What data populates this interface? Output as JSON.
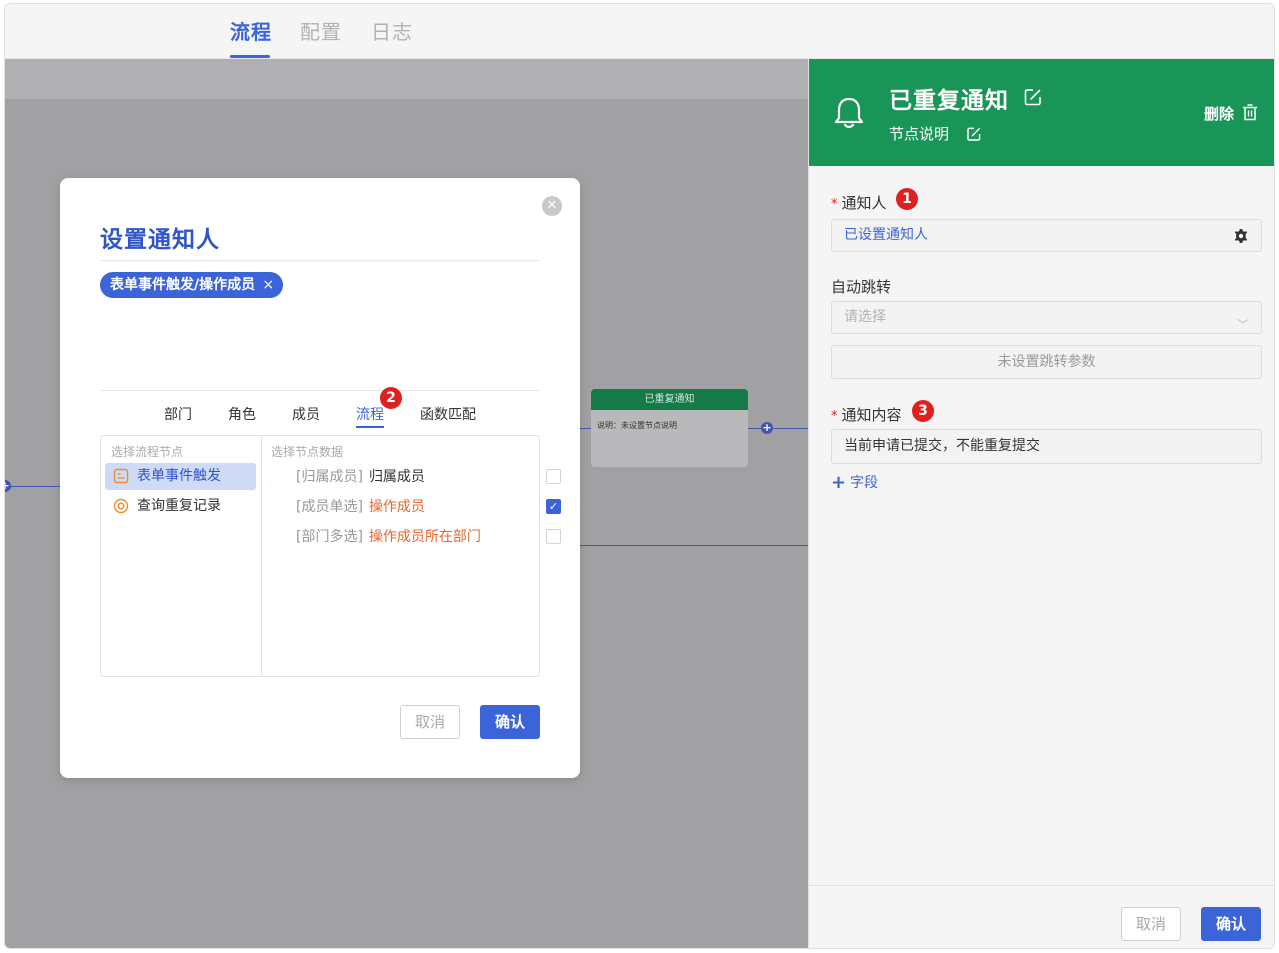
{
  "top_tabs": [
    {
      "label": "流程",
      "active": true
    },
    {
      "label": "配置",
      "active": false
    },
    {
      "label": "日志",
      "active": false
    }
  ],
  "canvas": {
    "node": {
      "title": "已重复通知",
      "description": "说明：未设置节点说明"
    }
  },
  "modal": {
    "title": "设置通知人",
    "close_icon": "close-circle-icon",
    "chip": {
      "label": "表单事件触发/操作成员",
      "remove_icon": "×"
    },
    "tabs": [
      {
        "label": "部门"
      },
      {
        "label": "角色"
      },
      {
        "label": "成员"
      },
      {
        "label": "流程",
        "active": true
      },
      {
        "label": "函数匹配"
      }
    ],
    "tab_badge": "2",
    "left_hint": "选择流程节点",
    "right_hint": "选择节点数据",
    "nodes": [
      {
        "label": "表单事件触发",
        "icon": "form-icon",
        "selected": true
      },
      {
        "label": "查询重复记录",
        "icon": "query-icon",
        "selected": false
      }
    ],
    "fields": [
      {
        "tag": "[归属成员]",
        "name": "归属成员",
        "checked": false
      },
      {
        "tag": "[成员单选]",
        "name": "操作成员",
        "checked": true
      },
      {
        "tag": "[部门多选]",
        "name": "操作成员所在部门",
        "checked": false
      }
    ],
    "cancel_label": "取消",
    "confirm_label": "确认"
  },
  "panel": {
    "title": "已重复通知",
    "subtitle": "节点说明",
    "delete_label": "删除",
    "notifier_label": "通知人",
    "notifier_badge": "1",
    "notifier_value": "已设置通知人",
    "auto_jump_label": "自动跳转",
    "auto_jump_placeholder": "请选择",
    "jump_params_label": "未设置跳转参数",
    "content_label": "通知内容",
    "content_badge": "3",
    "content_value": "当前申请已提交，不能重复提交",
    "add_field_label": "字段",
    "cancel_label": "取消",
    "confirm_label": "确认"
  },
  "colors": {
    "accent": "#3b64d8",
    "header_green": "#1a9558",
    "badge_red": "#e02020",
    "orange_text": "#e8672c"
  }
}
